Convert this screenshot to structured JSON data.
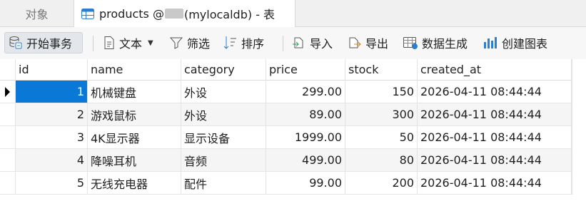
{
  "tabs": {
    "objects_label": "对象",
    "products_title_prefix": "products @",
    "products_title_suffix": "(mylocaldb) - 表"
  },
  "toolbar": {
    "begin_transaction": "开始事务",
    "text": "文本",
    "filter": "筛选",
    "sort": "排序",
    "import": "导入",
    "export": "导出",
    "data_generation": "数据生成",
    "create_chart": "创建图表"
  },
  "grid": {
    "columns": [
      "id",
      "name",
      "category",
      "price",
      "stock",
      "created_at"
    ],
    "rows": [
      {
        "id": "1",
        "name": "机械键盘",
        "category": "外设",
        "price": "299.00",
        "stock": "150",
        "created_at": "2026-04-11 08:44:44"
      },
      {
        "id": "2",
        "name": "游戏鼠标",
        "category": "外设",
        "price": "89.00",
        "stock": "300",
        "created_at": "2026-04-11 08:44:44"
      },
      {
        "id": "3",
        "name": "4K显示器",
        "category": "显示设备",
        "price": "1999.00",
        "stock": "50",
        "created_at": "2026-04-11 08:44:44"
      },
      {
        "id": "4",
        "name": "降噪耳机",
        "category": "音频",
        "price": "499.00",
        "stock": "80",
        "created_at": "2026-04-11 08:44:44"
      },
      {
        "id": "5",
        "name": "无线充电器",
        "category": "配件",
        "price": "99.00",
        "stock": "200",
        "created_at": "2026-04-11 08:44:44"
      }
    ]
  },
  "colors": {
    "selection": "#0a78d7",
    "accent_icon": "#2a7fd0"
  }
}
